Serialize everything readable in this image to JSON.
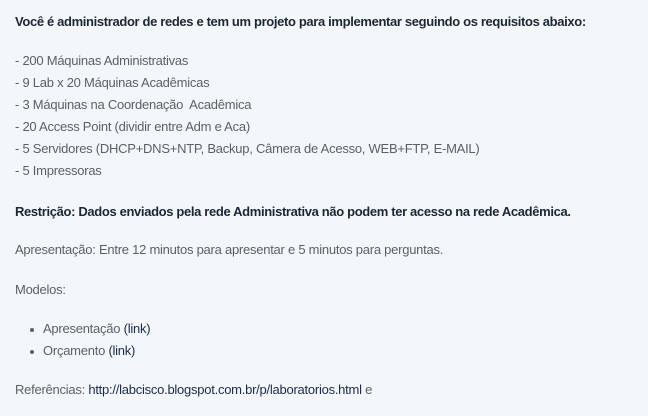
{
  "heading": "Você é administrador de redes e tem um projeto para implementar seguindo os requisitos abaixo:",
  "requirements": [
    "- 200 Máquinas Administrativas",
    "- 9 Lab x 20 Máquinas Acadêmicas",
    "- 3 Máquinas na Coordenação  Acadêmica",
    "- 20 Access Point (dividir entre Adm e Aca)",
    "- 5 Servidores (DHCP+DNS+NTP, Backup, Câmera de Acesso, WEB+FTP, E-MAIL)",
    "- 5 Impressoras"
  ],
  "restriction": "Restrição: Dados enviados pela rede Administrativa não podem ter acesso na rede Acadêmica.",
  "presentation": "Apresentação: Entre 12 minutos para apresentar e 5 minutos para perguntas.",
  "models_label": "Modelos:",
  "models": [
    {
      "name": "Apresentação",
      "link": "(link)"
    },
    {
      "name": "Orçamento",
      "link": "(link)"
    }
  ],
  "references": {
    "label": "Referências: ",
    "url": "http://labcisco.blogspot.com.br/p/laboratorios.html",
    "suffix": " e"
  }
}
